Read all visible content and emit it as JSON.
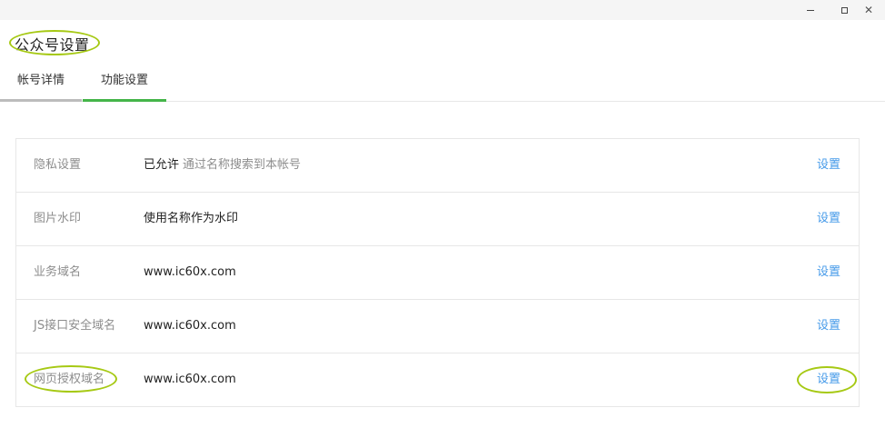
{
  "window": {
    "minimize_icon": "minimize-icon",
    "maximize_icon": "maximize-icon",
    "close_icon": "close-icon"
  },
  "page": {
    "title": "公众号设置"
  },
  "tabs": [
    {
      "label": "帐号详情",
      "active": false
    },
    {
      "label": "功能设置",
      "active": true
    }
  ],
  "settings": [
    {
      "label": "隐私设置",
      "status": "已允许",
      "value": "通过名称搜索到本帐号",
      "action": "设置"
    },
    {
      "label": "图片水印",
      "value": "使用名称作为水印",
      "action": "设置"
    },
    {
      "label": "业务域名",
      "value": "www.ic60x.com",
      "action": "设置"
    },
    {
      "label": "JS接口安全域名",
      "value": "www.ic60x.com",
      "action": "设置"
    },
    {
      "label": "网页授权域名",
      "value": "www.ic60x.com",
      "action": "设置"
    }
  ],
  "colors": {
    "accent_green": "#44b549",
    "link_blue": "#459ae9",
    "highlight_ring": "#a6c914"
  }
}
